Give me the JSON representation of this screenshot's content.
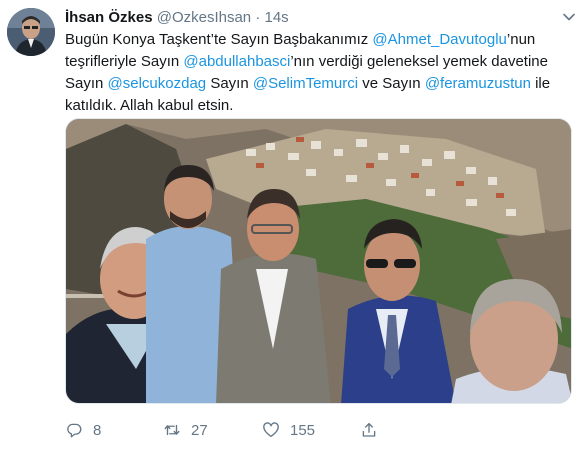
{
  "tweet": {
    "display_name": "İhsan Özkes",
    "handle": "@OzkesIhsan",
    "separator": "·",
    "time": "14s",
    "text": {
      "t1": "Bugün Konya Taşkent’te Sayın Başbakanımız ",
      "m1": "@Ahmet_Davutoglu",
      "t2": "’nun teşrifleriyle Sayın ",
      "m2": "@abdullahbasci",
      "t3": "’nın verdiği geleneksel yemek davetine Sayın ",
      "m3": "@selcukozdag",
      "t4": " Sayın ",
      "m4": "@SelimTemurci",
      "t5": " ve Sayın ",
      "m5": "@feramuzustun",
      "t6": " ile katıldık. Allah kabul etsin."
    },
    "actions": {
      "reply_count": "8",
      "retweet_count": "27",
      "like_count": "155"
    },
    "icons": {
      "menu": "chevron-down-icon",
      "reply": "reply-icon",
      "retweet": "retweet-icon",
      "like": "heart-icon",
      "share": "share-icon"
    },
    "colors": {
      "text": "#14171a",
      "secondary": "#657786",
      "link": "#1b95e0"
    }
  }
}
